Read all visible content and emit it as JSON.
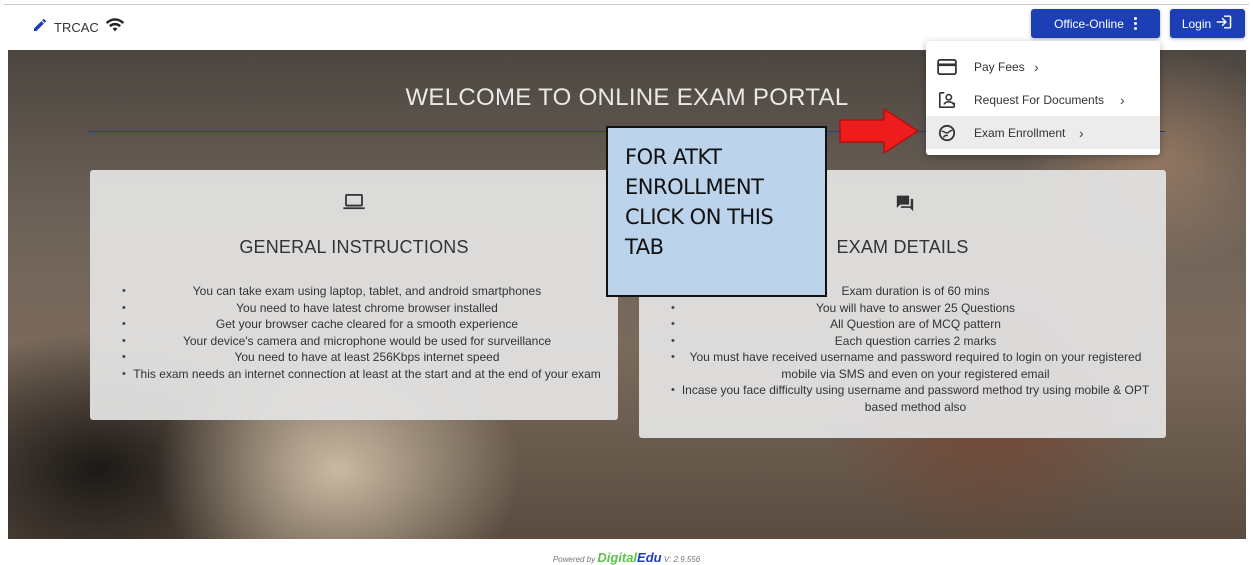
{
  "topbar": {
    "brand": "TRCAC",
    "office_button": "Office-Online",
    "login_button": "Login"
  },
  "dropdown": {
    "items": [
      {
        "label": "Pay Fees",
        "icon": "credit-card-icon"
      },
      {
        "label": "Request For Documents",
        "icon": "document-search-icon"
      },
      {
        "label": "Exam Enrollment",
        "icon": "globe-icon"
      }
    ]
  },
  "hero": {
    "title": "WELCOME TO ONLINE EXAM PORTAL"
  },
  "general_instructions": {
    "title": "GENERAL INSTRUCTIONS",
    "icon": "laptop-icon",
    "items": [
      "You can take exam using laptop, tablet, and android smartphones",
      "You need to have latest chrome browser installed",
      "Get your browser cache cleared for a smooth experience",
      "Your device's camera and microphone would be used for surveillance",
      "You need to have at least 256Kbps internet speed",
      "This exam needs an internet connection at least at the start and at the end of your exam"
    ]
  },
  "exam_details": {
    "title": "EXAM DETAILS",
    "icon": "forum-icon",
    "items": [
      "Exam duration is of 60 mins",
      "You will have to answer 25 Questions",
      "All Question are of MCQ pattern",
      "Each question carries 2 marks",
      "You must have received username and password required to login on your registered mobile via SMS and even on your registered email",
      "Incase you face difficulty using username and password method try using mobile & OPT based method also"
    ]
  },
  "callout": {
    "lines": [
      "FOR ATKT",
      "ENROLLMENT",
      "CLICK ON THIS",
      "TAB"
    ]
  },
  "footer": {
    "powered_by": "Powered by",
    "brand_a": "Digital",
    "brand_b": "Edu",
    "version": "V: 2.9.556"
  }
}
